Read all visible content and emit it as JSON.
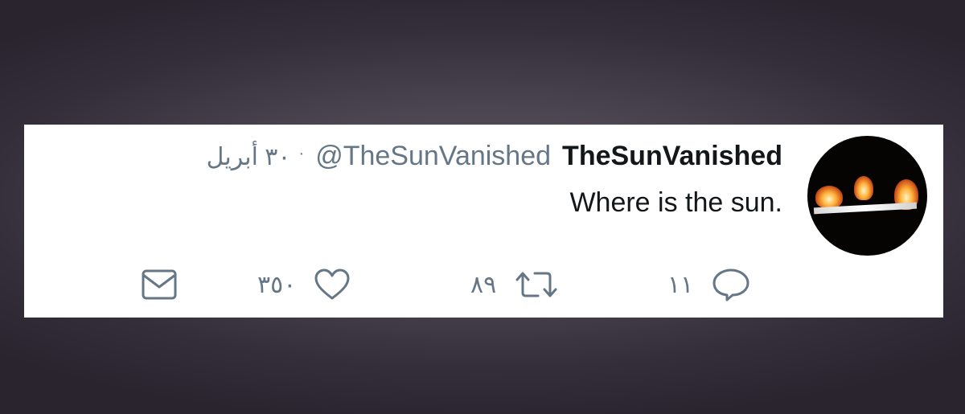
{
  "tweet": {
    "display_name": "TheSunVanished",
    "handle": "@TheSunVanished",
    "separator": "·",
    "date": "٣٠ أبريل",
    "text": "Where is the sun."
  },
  "actions": {
    "reply_count": "١١",
    "retweet_count": "٨٩",
    "like_count": "٣٥٠"
  },
  "icons": {
    "reply": "reply-bubble-icon",
    "retweet": "retweet-icon",
    "like": "heart-icon",
    "dm": "envelope-icon"
  },
  "colors": {
    "secondary_text": "#657786",
    "primary_text": "#14171a",
    "card_background": "#ffffff"
  }
}
